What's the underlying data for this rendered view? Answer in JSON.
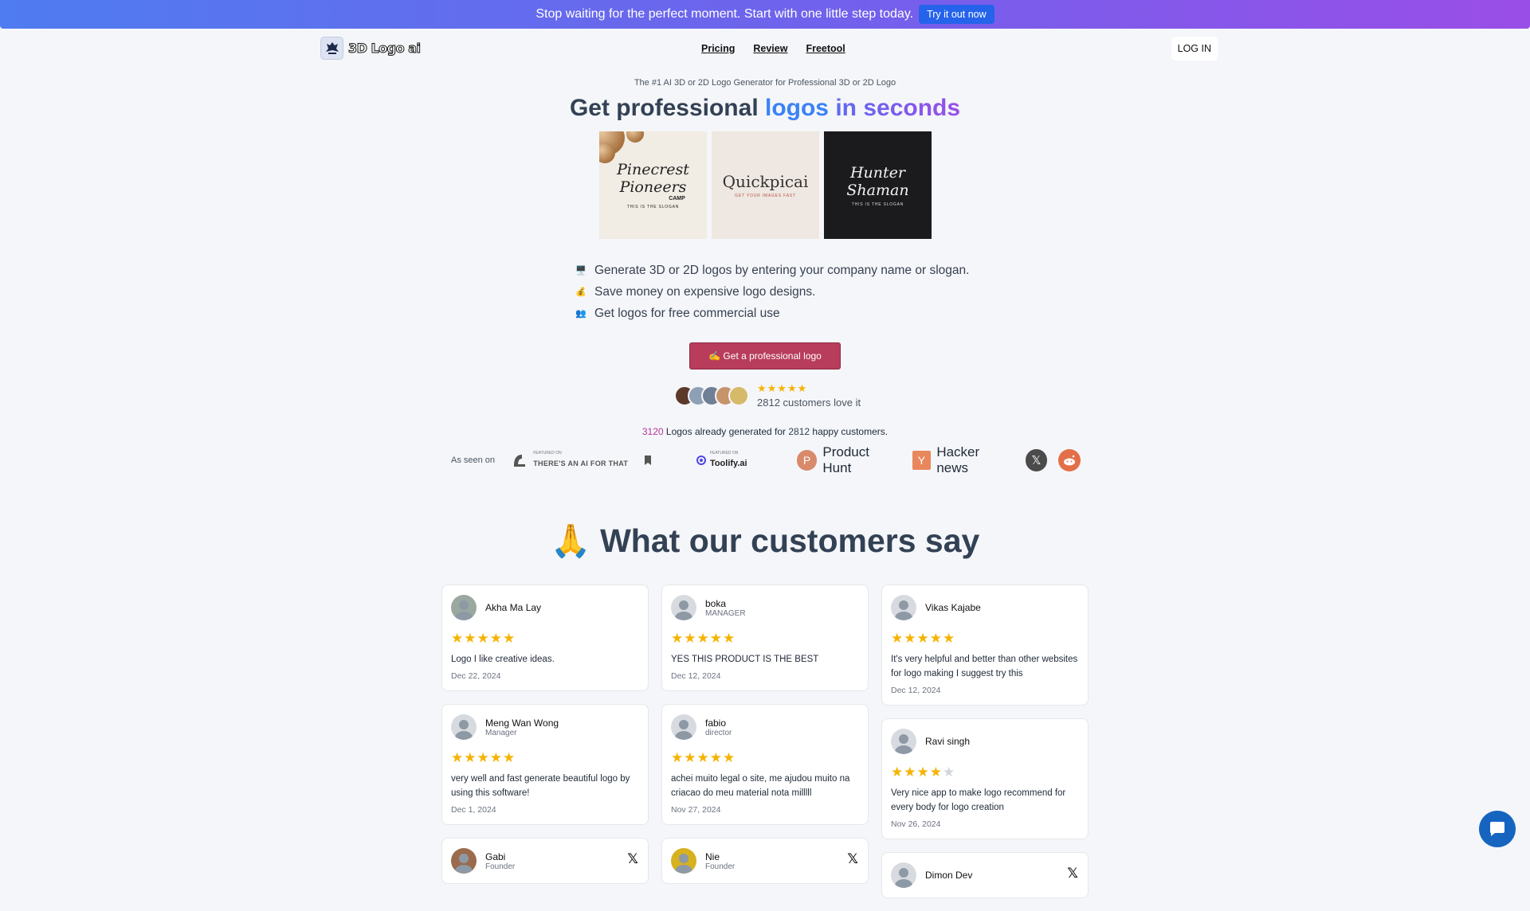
{
  "banner": {
    "text": "Stop waiting for the perfect moment. Start with one little step today.",
    "button": "Try it out now"
  },
  "nav": {
    "brand": "3D Logo ai",
    "links": [
      "Pricing",
      "Review",
      "Freetool"
    ],
    "login": "LOG IN"
  },
  "hero": {
    "tagline": "The #1 AI 3D or 2D Logo Generator for Professional 3D or 2D Logo",
    "title_plain": "Get professional ",
    "title_accent1": "logos",
    "title_accent2": " in seconds",
    "samples": [
      {
        "main": "Pinecrest Pioneers",
        "extra": "CAMP",
        "sub": "THIS IS THE SLOGAN"
      },
      {
        "main": "Quickpicai",
        "sub": "GET YOUR IMAGES FAST"
      },
      {
        "main": "Hunter Shaman",
        "sub": "THIS IS THE SLOGAN"
      }
    ],
    "features": [
      {
        "icon": "🖥️",
        "text": "Generate 3D or 2D logos by entering your company name or slogan."
      },
      {
        "icon": "💰",
        "text": "Save money on expensive logo designs."
      },
      {
        "icon": "👥",
        "text": "Get logos for free commercial use"
      }
    ],
    "cta": "✍️ Get a professional logo",
    "rating_stars": "★★★★★",
    "customers_love": "2812 customers love it"
  },
  "stats": {
    "logos_count": "3120",
    "logos_text": " Logos already generated for ",
    "customers_count": "2812",
    "customers_text": " happy customers."
  },
  "seen_on": {
    "label": "As seen on",
    "aift_featured": "FEATURED ON",
    "aift_name": "THERE'S AN AI FOR THAT",
    "toolify_featured": "FEATURED ON",
    "toolify_name": "Toolify.ai",
    "producthunt_letter": "P",
    "producthunt": "Product Hunt",
    "hackernews_letter": "Y",
    "hackernews": "Hacker news",
    "x_letter": "𝕏"
  },
  "testimonials": {
    "title": "🙏 What our customers say",
    "columns": [
      [
        {
          "name": "Akha Ma Lay",
          "role": "",
          "rating": 5,
          "text": "Logo I like creative ideas.",
          "date": "Dec 22, 2024",
          "x": false
        },
        {
          "name": "Meng Wan Wong",
          "role": "Manager",
          "rating": 5,
          "text": "very well and fast generate beautiful logo by using this software!",
          "date": "Dec 1, 2024",
          "x": false
        },
        {
          "name": "Gabi",
          "role": "Founder",
          "rating": 0,
          "text": "",
          "date": "",
          "x": true
        }
      ],
      [
        {
          "name": "boka",
          "role": "MANAGER",
          "rating": 5,
          "text": "YES THIS PRODUCT IS THE BEST",
          "date": "Dec 12, 2024",
          "x": false
        },
        {
          "name": "fabio",
          "role": "director",
          "rating": 5,
          "text": "achei muito legal o site, me ajudou muito na criacao do meu material nota milllll",
          "date": "Nov 27, 2024",
          "x": false
        },
        {
          "name": "Nie",
          "role": "Founder",
          "rating": 0,
          "text": "",
          "date": "",
          "x": true
        }
      ],
      [
        {
          "name": "Vikas Kajabe",
          "role": "",
          "rating": 5,
          "text": "It's very helpful and better than other websites for logo making I suggest try this",
          "date": "Dec 12, 2024",
          "x": false
        },
        {
          "name": "Ravi singh",
          "role": "",
          "rating": 4,
          "text": "Very nice app to make logo recommend for every body for logo creation",
          "date": "Nov 26, 2024",
          "x": false
        },
        {
          "name": "Dimon Dev",
          "role": "",
          "rating": 0,
          "text": "",
          "date": "",
          "x": true
        }
      ]
    ]
  },
  "colors": {
    "accent": "#b83c5c",
    "star": "#f5b300",
    "banner_start": "#4f7cf0",
    "banner_end": "#9a4ee8"
  },
  "icons": {
    "chat": "chat-bubble-icon"
  }
}
